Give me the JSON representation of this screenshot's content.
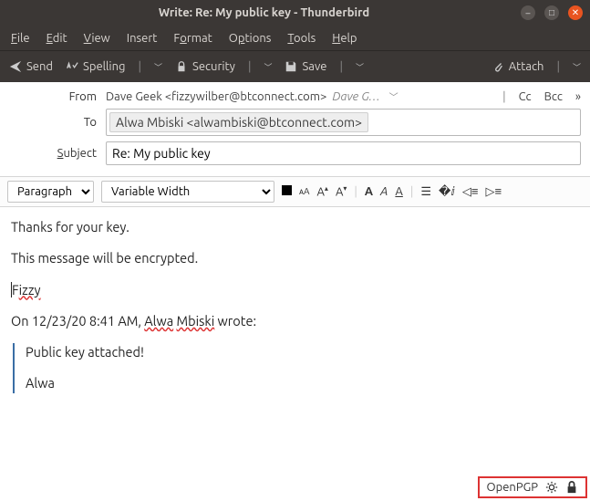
{
  "window": {
    "title": "Write: Re: My public key - Thunderbird"
  },
  "menu": {
    "file": "File",
    "edit": "Edit",
    "view": "View",
    "insert": "Insert",
    "format": "Format",
    "options": "Options",
    "tools": "Tools",
    "help": "Help"
  },
  "toolbar": {
    "send": "Send",
    "spelling": "Spelling",
    "security": "Security",
    "save": "Save",
    "attach": "Attach"
  },
  "headers": {
    "from_label": "From",
    "from_value": "Dave Geek <fizzywilber@btconnect.com>",
    "from_identity": "Dave G…",
    "cc": "Cc",
    "bcc": "Bcc",
    "to_label": "To",
    "to_value": "Alwa Mbiski <alwambiski@btconnect.com>",
    "subject_label": "Subject",
    "subject_value": "Re: My public key"
  },
  "format": {
    "para_style": "Paragraph",
    "font_family": "Variable Width"
  },
  "body": {
    "l1": "Thanks for your key.",
    "l2": "This message will be encrypted.",
    "l3a": "F",
    "l3b": "izzy",
    "l4a": "On 12/23/20 8:41 AM, ",
    "l4b": "Alwa",
    "l4c": " ",
    "l4d": "Mbiski",
    "l4e": " wrote:",
    "q1": "Public key attached!",
    "q2": "Alwa"
  },
  "status": {
    "label": "OpenPGP"
  }
}
